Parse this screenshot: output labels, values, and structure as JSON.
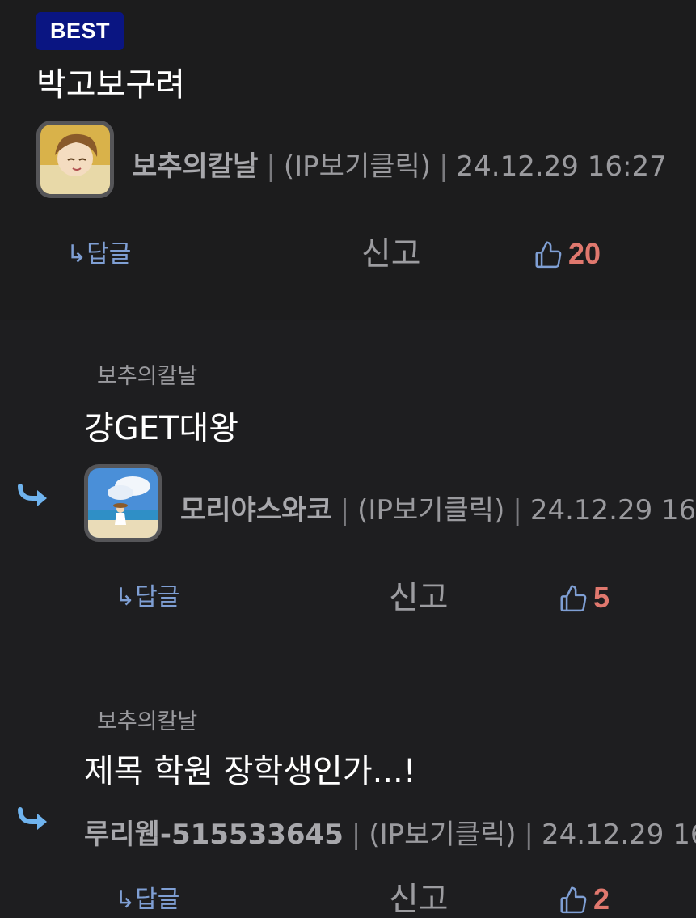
{
  "best_label": "BEST",
  "comments": [
    {
      "title": "박고보구려",
      "nickname": "보추의칼날",
      "ip_label": "(IP보기클릭)",
      "timestamp": "24.12.29 16:27",
      "reply_label": "↳답글",
      "report_label": "신고",
      "likes": "20"
    },
    {
      "parent_nickname": "보추의칼날",
      "title": "걍GET대왕",
      "nickname": "모리야스와코",
      "ip_label": "(IP보기클릭)",
      "timestamp": "24.12.29 16",
      "reply_label": "↳답글",
      "report_label": "신고",
      "likes": "5"
    },
    {
      "parent_nickname": "보추의칼날",
      "title": "제목 학원 장학생인가...!",
      "nickname": "루리웹-515533645",
      "ip_label": "(IP보기클릭)",
      "timestamp": "24.12.29 16:",
      "reply_label": "↳답글",
      "report_label": "신고",
      "likes": "2"
    }
  ],
  "colors": {
    "background": "#1e1e20",
    "best_badge": "#0a1582",
    "link": "#7f9fd4",
    "like_count": "#e0786e",
    "reply_arrow": "#6fb3ee"
  }
}
